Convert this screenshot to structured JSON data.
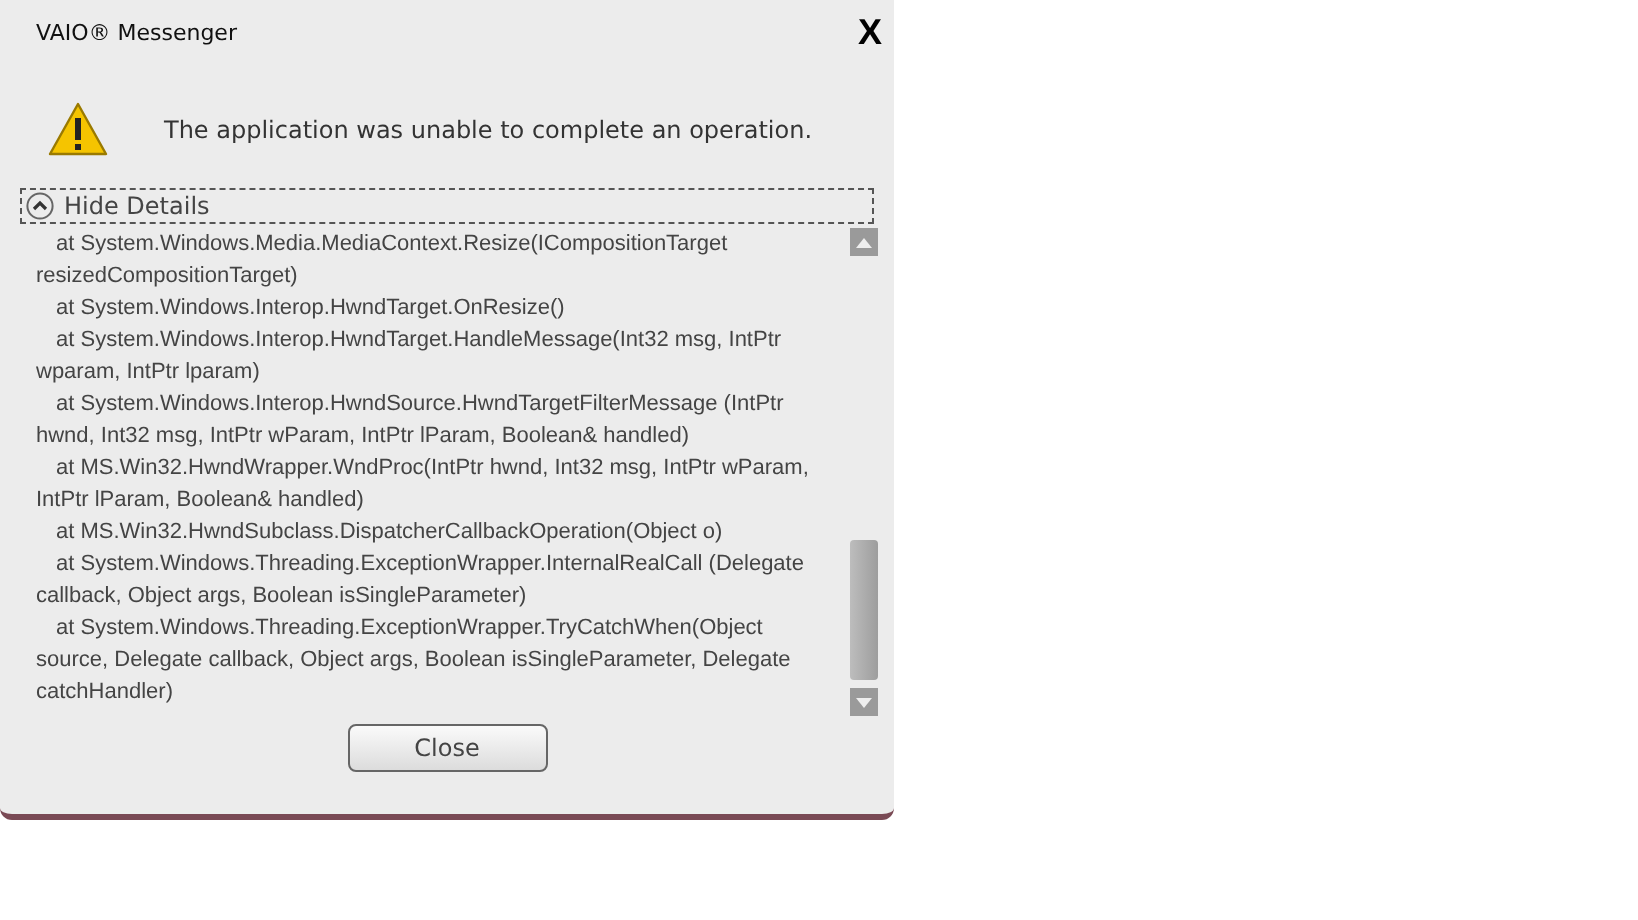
{
  "window": {
    "title": "VAIO® Messenger",
    "close": "X"
  },
  "message": "The application was unable to complete an operation.",
  "details": {
    "label": "Hide Details",
    "expanded": true,
    "lines": [
      "at System.Windows.Media.MediaContext.Resize(ICompositionTarget resizedCompositionTarget)",
      "at System.Windows.Interop.HwndTarget.OnResize()",
      "at System.Windows.Interop.HwndTarget.HandleMessage(Int32 msg, IntPtr wparam, IntPtr lparam)",
      "at System.Windows.Interop.HwndSource.HwndTargetFilterMessage (IntPtr hwnd, Int32 msg, IntPtr wParam, IntPtr lParam, Boolean& handled)",
      "at MS.Win32.HwndWrapper.WndProc(IntPtr hwnd, Int32 msg, IntPtr wParam, IntPtr lParam, Boolean& handled)",
      "at MS.Win32.HwndSubclass.DispatcherCallbackOperation(Object o)",
      "at System.Windows.Threading.ExceptionWrapper.InternalRealCall (Delegate callback, Object args, Boolean isSingleParameter)",
      "at System.Windows.Threading.ExceptionWrapper.TryCatchWhen(Object source, Delegate callback, Object args, Boolean isSingleParameter, Delegate catchHandler)"
    ]
  },
  "buttons": [
    "Close"
  ]
}
